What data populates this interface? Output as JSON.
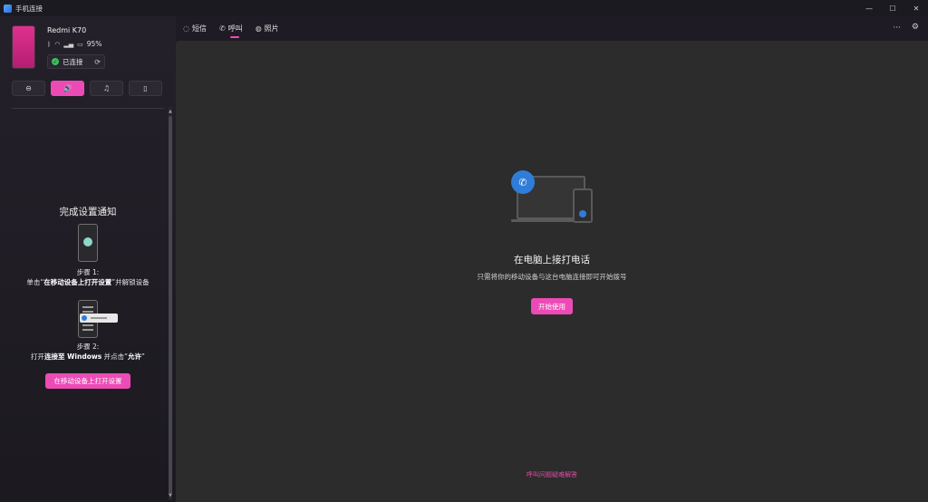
{
  "window": {
    "title": "手机连接",
    "minimize": "—",
    "maximize": "☐",
    "close": "✕"
  },
  "sidebar": {
    "device_name": "Redmi K70",
    "battery": "95%",
    "status_icons": [
      "bluetooth-icon",
      "wifi-icon",
      "signal-icon",
      "battery-icon"
    ],
    "connected_label": "已连接",
    "quick_actions": [
      {
        "name": "do-not-disturb",
        "glyph": "⊖",
        "active": false
      },
      {
        "name": "audio",
        "glyph": "🔊",
        "active": true
      },
      {
        "name": "music",
        "glyph": "♫",
        "active": false
      },
      {
        "name": "media",
        "glyph": "▯",
        "active": false
      }
    ],
    "setup_title": "完成设置通知",
    "step1_label": "步骤 1:",
    "step1_pre": "单击“",
    "step1_bold": "在移动设备上打开设置",
    "step1_post": "”并解锁设备",
    "step2_label": "步骤 2:",
    "step2_pre": "打开",
    "step2_bold1": "连接至 Windows",
    "step2_mid": " 并点击“",
    "step2_bold2": "允许",
    "step2_post": "”",
    "open_settings_button": "在移动设备上打开设置"
  },
  "nav": {
    "tabs": [
      {
        "label": "短信",
        "icon": "message-icon"
      },
      {
        "label": "呼叫",
        "icon": "phone-icon",
        "active": true
      },
      {
        "label": "照片",
        "icon": "photo-icon"
      }
    ],
    "more": "···",
    "settings": "⚙"
  },
  "main": {
    "title": "在电脑上接打电话",
    "description": "只需将你的移动设备与这台电脑连接即可开始拨号",
    "start_button": "开始使用",
    "bottom_link": "呼叫问题疑难解答"
  },
  "colors": {
    "accent": "#ec4bb6",
    "blue": "#2f7dd8",
    "connected": "#3dbf5e"
  }
}
